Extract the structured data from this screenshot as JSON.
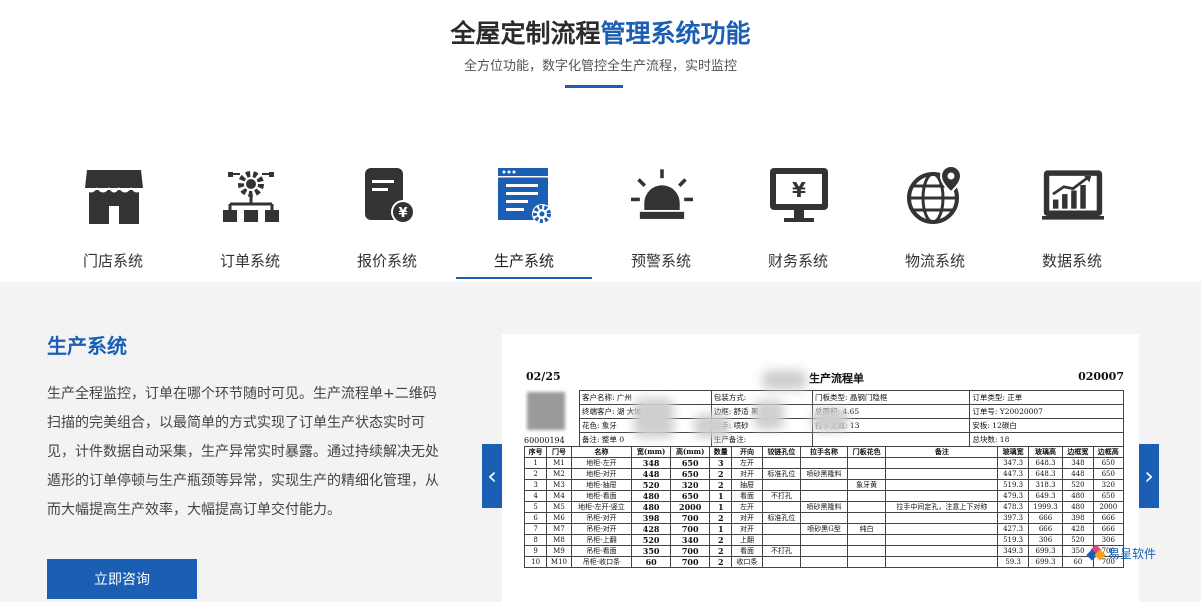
{
  "header": {
    "title_main": "全屋定制流程",
    "title_accent": "管理系统功能",
    "subtitle": "全方位功能，数字化管控全生产流程，实时监控"
  },
  "tabs": [
    {
      "label": "门店系统",
      "icon": "store-icon"
    },
    {
      "label": "订单系统",
      "icon": "gear-flow-icon"
    },
    {
      "label": "报价系统",
      "icon": "quote-document-icon"
    },
    {
      "label": "生产系统",
      "icon": "production-window-icon",
      "active": true
    },
    {
      "label": "预警系统",
      "icon": "alarm-light-icon"
    },
    {
      "label": "财务系统",
      "icon": "finance-monitor-icon"
    },
    {
      "label": "物流系统",
      "icon": "globe-location-icon"
    },
    {
      "label": "数据系统",
      "icon": "data-chart-icon"
    }
  ],
  "section": {
    "title": "生产系统",
    "description": "生产全程监控，订单在哪个环节随时可见。生产流程单+二维码扫描的完美组合，以最简单的方式实现了订单生产状态实时可见，计件数据自动采集，生产异常实时暴露。通过持续解决无处遁形的订单停顿与生产瓶颈等异常，实现生产的精细化管理，从而大幅提高生产效率，大幅提高订单交付能力。",
    "button_label": "立即咨询"
  },
  "slider": {
    "prev_symbol": "‹",
    "next_symbol": "›"
  },
  "document": {
    "date": "02/25",
    "title": "生产流程单",
    "number": "020007",
    "number2": "60000194",
    "info_rows": [
      [
        "客户名称: 广州",
        "包装方式:",
        "门板类型: 晶钢门隐框",
        "订单类型: 正单"
      ],
      [
        "终端客户: 湖",
        "大城",
        "边框: 舒适",
        "黑",
        "总面积: 4.65",
        "订单号: Y20020007"
      ],
      [
        "花色: 象牙",
        "拉手: 喷砂",
        "拉手支数: 13",
        "安板: 12碳白"
      ],
      [
        "备注: 整单",
        "0",
        "生产备注:",
        "总块数: 18"
      ]
    ],
    "columns": [
      "序号",
      "门号",
      "名称",
      "宽(mm)",
      "高(mm)",
      "数量",
      "开向",
      "铰链孔位",
      "拉手名称",
      "门板花色",
      "备注",
      "玻璃宽",
      "玻璃高",
      "边框宽",
      "边框高"
    ],
    "rows": [
      [
        "1",
        "M1",
        "地柜-左开",
        "348",
        "650",
        "3",
        "左开",
        "",
        "",
        "",
        "",
        "347.3",
        "648.3",
        "348",
        "650"
      ],
      [
        "2",
        "M2",
        "地柜-对开",
        "448",
        "650",
        "2",
        "对开",
        "标准孔位",
        "喷砂黑隆料",
        "",
        "",
        "447.3",
        "648.3",
        "448",
        "650"
      ],
      [
        "3",
        "M3",
        "地柜-抽屉",
        "520",
        "320",
        "2",
        "抽屉",
        "",
        "",
        "象牙黄",
        "",
        "519.3",
        "318.3",
        "520",
        "320"
      ],
      [
        "4",
        "M4",
        "地柜-看面",
        "480",
        "650",
        "1",
        "看面",
        "不打孔",
        "",
        "",
        "",
        "479.3",
        "649.3",
        "480",
        "650"
      ],
      [
        "5",
        "M5",
        "地柜-左开-竖立",
        "480",
        "2000",
        "1",
        "左开",
        "",
        "喷砂黑隆料",
        "",
        "拉手中间定孔，注意上下对称",
        "478.3",
        "1999.3",
        "480",
        "2000"
      ],
      [
        "6",
        "M6",
        "吊柜-对开",
        "398",
        "700",
        "2",
        "对开",
        "标准孔位",
        "",
        "",
        "",
        "397.3",
        "666",
        "398",
        "666"
      ],
      [
        "7",
        "M7",
        "吊柜-对开",
        "428",
        "700",
        "1",
        "对开",
        "",
        "喷砂黑G型",
        "纯白",
        "",
        "427.3",
        "666",
        "428",
        "666"
      ],
      [
        "8",
        "M8",
        "吊柜-上翻",
        "520",
        "340",
        "2",
        "上翻",
        "",
        "",
        "",
        "",
        "519.3",
        "306",
        "520",
        "306"
      ],
      [
        "9",
        "M9",
        "吊柜-看面",
        "350",
        "700",
        "2",
        "看面",
        "不打孔",
        "",
        "",
        "",
        "349.3",
        "699.3",
        "350",
        "700"
      ],
      [
        "10",
        "M10",
        "吊柜-收口条",
        "60",
        "700",
        "2",
        "收口条",
        "",
        "",
        "",
        "",
        "59.3",
        "699.3",
        "60",
        "700"
      ]
    ]
  },
  "watermark": {
    "text": "易呈软件"
  },
  "colors": {
    "accent": "#1a5fb4",
    "panel_bg": "#f3f3f3",
    "icon_dark": "#333333",
    "icon_blue": "#1a5fb4"
  }
}
